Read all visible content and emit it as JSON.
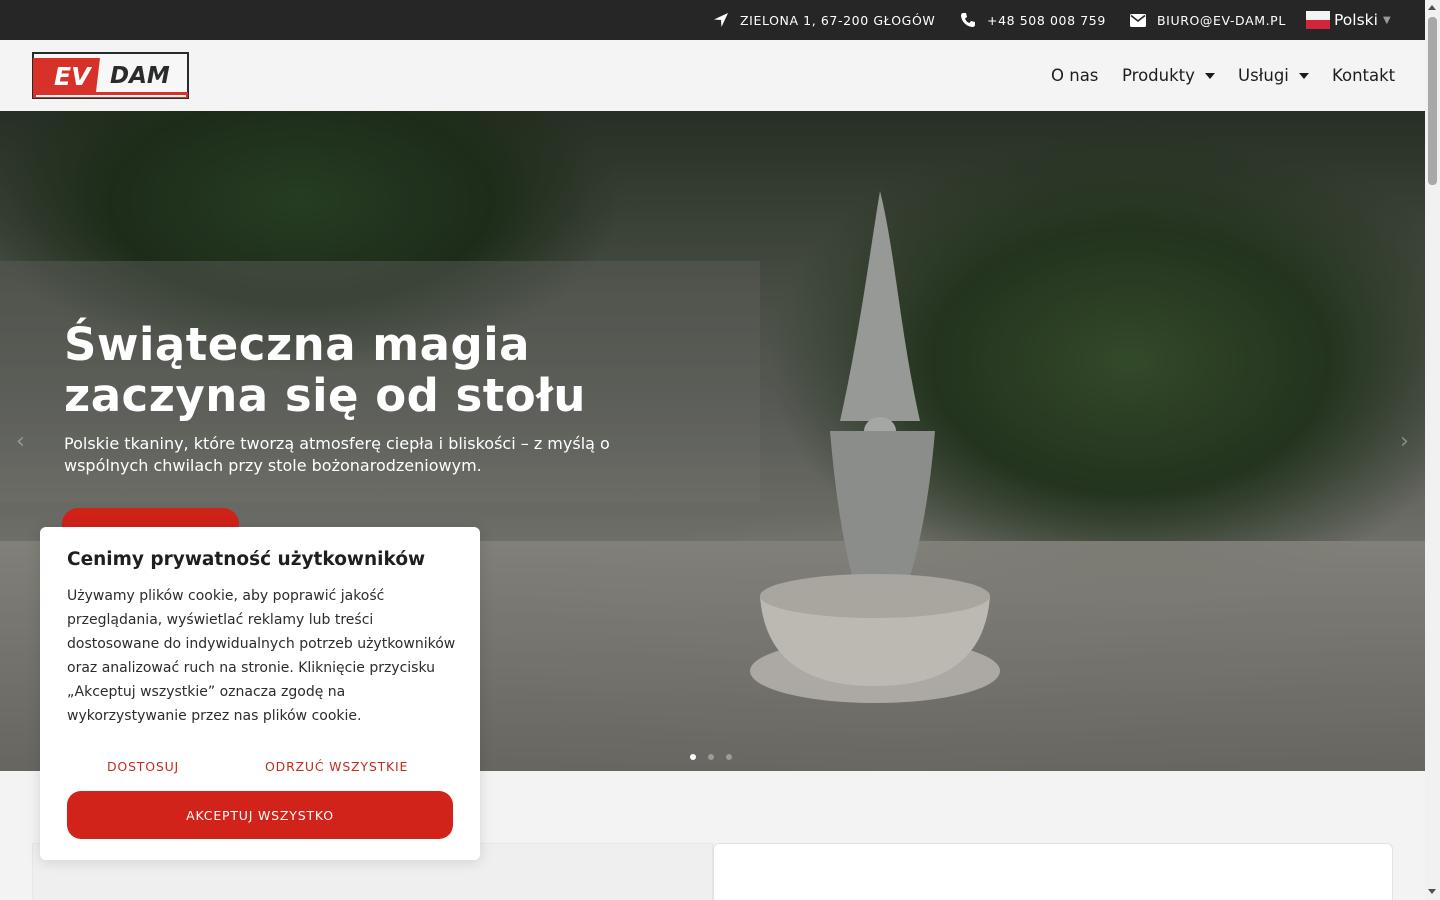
{
  "topbar": {
    "address": "ZIELONA 1, 67-200 GŁOGÓW",
    "phone": "+48 508 008 759",
    "email": "BIURO@EV-DAM.PL",
    "language": "Polski",
    "address_icon": "location-arrow-icon",
    "phone_icon": "phone-icon",
    "email_icon": "envelope-icon",
    "flag_icon": "poland-flag-icon"
  },
  "header": {
    "logo_text_left": "EV",
    "logo_text_right": "DAM",
    "nav": [
      {
        "label": "O nas"
      },
      {
        "label": "Produkty"
      },
      {
        "label": "Usługi"
      },
      {
        "label": "Kontakt"
      }
    ]
  },
  "hero": {
    "title": "Świąteczna magia zaczyna się od stołu",
    "subtitle": "Polskie tkaniny, które tworzą atmosferę ciepła i bliskości – z myślą o wspólnych chwilach przy stole bożonarodzeniowym.",
    "slides_total": 3,
    "active_slide": 1
  },
  "cookie": {
    "title": "Cenimy prywatność użytkowników",
    "body": "Używamy plików cookie, aby poprawić jakość przeglądania, wyświetlać reklamy lub treści dostosowane do indywidualnych potrzeb użytkowników oraz analizować ruch na stronie. Kliknięcie przycisku „Akceptuj wszystkie” oznacza zgodę na wykorzystywanie przez nas plików cookie.",
    "customize_label": "DOSTOSUJ",
    "reject_label": "ODRZUĆ WSZYSTKIE",
    "accept_label": "AKCEPTUJ WSZYSTKO"
  },
  "colors": {
    "accent": "#d2231b",
    "topbar": "#262626",
    "header": "#f4f4f4"
  }
}
